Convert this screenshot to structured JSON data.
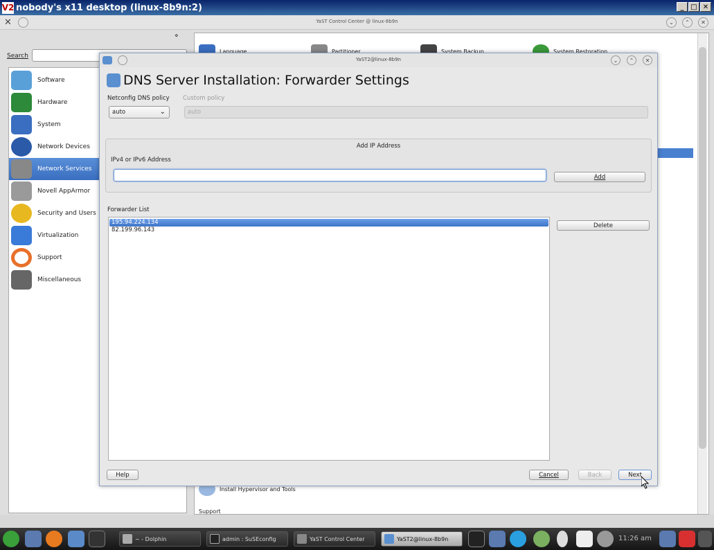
{
  "vnc": {
    "title": "nobody's x11 desktop (linux-8b9n:2)",
    "logo": "V2"
  },
  "control_center": {
    "title": "YaST Control Center @ linux-8b9n",
    "search_label": "Search",
    "search_value": "",
    "categories": [
      {
        "label": "Software",
        "icon": "software-icon",
        "color": "#5aa0d8"
      },
      {
        "label": "Hardware",
        "icon": "hardware-icon",
        "color": "#2c8a3a"
      },
      {
        "label": "System",
        "icon": "system-icon",
        "color": "#3a6ec0"
      },
      {
        "label": "Network Devices",
        "icon": "network-devices-icon",
        "color": "#2a5aa8"
      },
      {
        "label": "Network Services",
        "icon": "network-services-icon",
        "color": "#888888"
      },
      {
        "label": "Novell AppArmor",
        "icon": "apparmor-icon",
        "color": "#9a9a9a"
      },
      {
        "label": "Security and Users",
        "icon": "security-icon",
        "color": "#e8b820"
      },
      {
        "label": "Virtualization",
        "icon": "virtualization-icon",
        "color": "#3a7ad8"
      },
      {
        "label": "Support",
        "icon": "support-icon",
        "color": "#e8702a"
      },
      {
        "label": "Miscellaneous",
        "icon": "miscellaneous-icon",
        "color": "#666666"
      }
    ],
    "selected_category": "Network Services",
    "background_items": [
      {
        "label": "Language",
        "icon": "language-icon"
      },
      {
        "label": "Partitioner",
        "icon": "partitioner-icon"
      },
      {
        "label": "System Backup",
        "icon": "backup-icon"
      },
      {
        "label": "System Restoration",
        "icon": "restore-icon"
      },
      {
        "label": "Install Hypervisor and Tools",
        "icon": "hypervisor-icon"
      },
      {
        "label": "Support",
        "icon": "support-icon"
      }
    ]
  },
  "dialog": {
    "window_title": "YaST2@linux-8b9n",
    "heading": "DNS Server Installation: Forwarder Settings",
    "netconfig_label": "Netconfig DNS policy",
    "netconfig_value": "auto",
    "custom_policy_label": "Custom policy",
    "custom_policy_value": "auto",
    "add_ip_title": "Add IP Address",
    "ip_label": "IPv4 or IPv6 Address",
    "ip_value": "",
    "add_button": "Add",
    "forwarder_list_label": "Forwarder List",
    "forwarders": [
      "195.94.224.134",
      "82.199.96.143"
    ],
    "selected_forwarder": "195.94.224.134",
    "delete_button": "Delete",
    "help_button": "Help",
    "cancel_button": "Cancel",
    "back_button": "Back",
    "next_button": "Next"
  },
  "taskbar": {
    "tasks": [
      {
        "label": "~ - Dolphin",
        "active": false
      },
      {
        "label": "admin : SuSEconfig",
        "active": false
      },
      {
        "label": "YaST Control Center",
        "active": false
      },
      {
        "label": "YaST2@linux-8b9n",
        "active": true
      }
    ],
    "clock": "11:26 am"
  }
}
